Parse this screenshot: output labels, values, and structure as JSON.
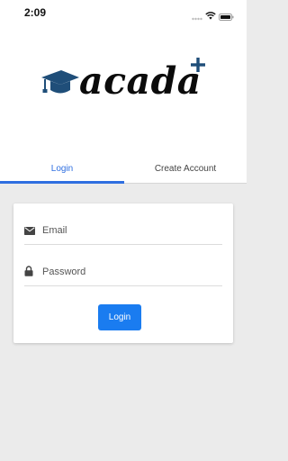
{
  "status_bar": {
    "time": "2:09",
    "icons": [
      "signal-icon",
      "wifi-icon",
      "battery-icon"
    ]
  },
  "logo": {
    "word": "acada",
    "plus": "+",
    "cap_icon": "graduation-cap-icon"
  },
  "tabs": [
    {
      "label": "Login",
      "active": true
    },
    {
      "label": "Create Account",
      "active": false
    }
  ],
  "form": {
    "email_placeholder": "Email",
    "email_value": "",
    "email_icon": "envelope-icon",
    "password_placeholder": "Password",
    "password_value": "",
    "password_icon": "lock-icon",
    "submit_label": "Login"
  },
  "colors": {
    "accent": "#2f6fe0",
    "button": "#1a7cf0",
    "logo_blue": "#1f4e79",
    "background": "#ebebeb"
  }
}
